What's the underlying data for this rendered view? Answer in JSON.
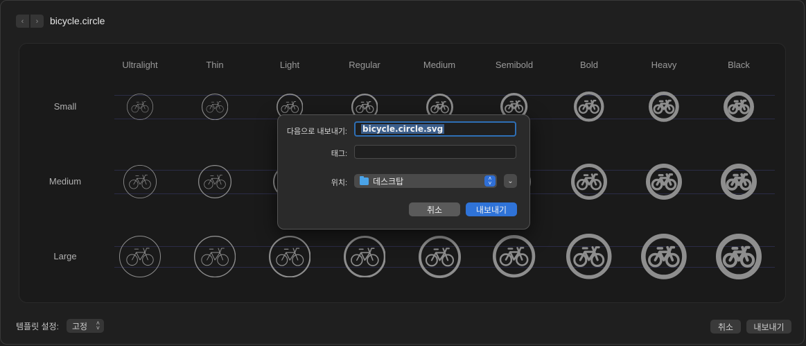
{
  "window": {
    "title": "bicycle.circle"
  },
  "grid": {
    "weights": [
      "Ultralight",
      "Thin",
      "Light",
      "Regular",
      "Medium",
      "Semibold",
      "Bold",
      "Heavy",
      "Black"
    ],
    "scales": [
      "Small",
      "Medium",
      "Large"
    ],
    "symbol_icon": "bicycle-circle-icon",
    "symbol_color": "#8e8e8e"
  },
  "bottom": {
    "template_label": "템플릿 설정:",
    "template_value": "고정",
    "cancel_label": "취소",
    "export_label": "내보내기"
  },
  "dialog": {
    "export_as_label": "다음으로 내보내기:",
    "filename": "bicycle.circle.svg",
    "tags_label": "태그:",
    "tags_value": "",
    "location_label": "위치:",
    "location_value": "데스크탑",
    "cancel_label": "취소",
    "export_label": "내보내기",
    "accent_color": "#2f73d8"
  }
}
